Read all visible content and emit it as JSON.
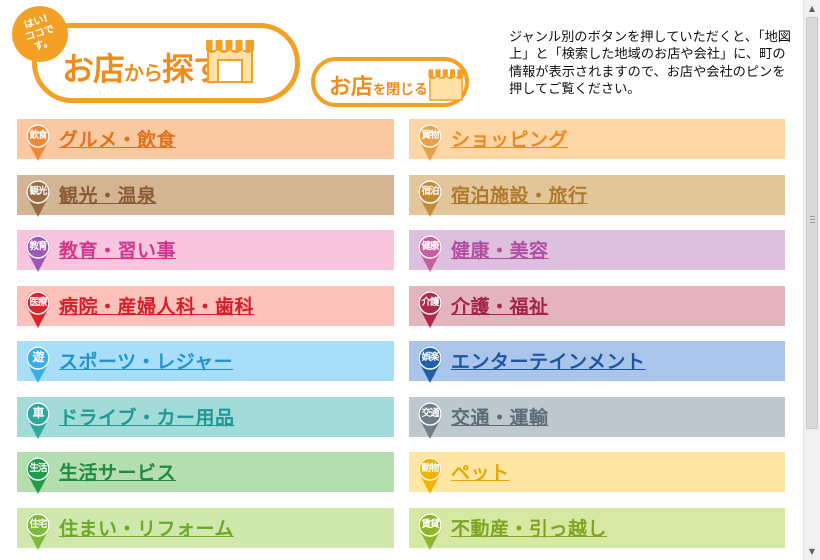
{
  "header": {
    "badge_line1": "はい!",
    "badge_line2": "ココです。",
    "search_title_big": "お店",
    "search_title_small": "から",
    "search_title_end": "探す!",
    "close_big": "お店",
    "close_small": "を",
    "close_end": "閉じる!",
    "instructions": "ジャンル別のボタンを押していただくと、「地図上」と「検索した地域のお店や会社」に、町の情報が表示されますので、お店や会社のピンを押してご覧ください。",
    "accent_color": "#f4a024"
  },
  "genres": [
    {
      "icon": "飲食",
      "label": "グルメ・飲食",
      "bg": "#fbc9a1",
      "pin": "#ee8a3a",
      "text": "#e0701e"
    },
    {
      "icon": "買物",
      "label": "ショッピング",
      "bg": "#fdd6a6",
      "pin": "#e8a146",
      "text": "#e98a25"
    },
    {
      "icon": "観光",
      "label": "観光・温泉",
      "bg": "#d3b596",
      "pin": "#9a6a44",
      "text": "#8c5a33"
    },
    {
      "icon": "宿泊",
      "label": "宿泊施設・旅行",
      "bg": "#e2c598",
      "pin": "#c08b3a",
      "text": "#b07a2c"
    },
    {
      "icon": "教育",
      "label": "教育・習い事",
      "bg": "#f9c5de",
      "pin": "#9b58b5",
      "text": "#d0378c"
    },
    {
      "icon": "健康",
      "label": "健康・美容",
      "bg": "#dcc0de",
      "pin": "#c85e9f",
      "text": "#b24ea0"
    },
    {
      "icon": "医療",
      "label": "病院・産婦人科・歯科",
      "bg": "#fcc1ba",
      "pin": "#d8262e",
      "text": "#d31f29"
    },
    {
      "icon": "介護",
      "label": "介護・福祉",
      "bg": "#e4b4bd",
      "pin": "#b0284a",
      "text": "#a4244a"
    },
    {
      "icon": "遊",
      "label": "スポーツ・レジャー",
      "bg": "#a9def8",
      "pin": "#3aaee3",
      "text": "#2293cf"
    },
    {
      "icon": "娯楽",
      "label": "エンターテインメント",
      "bg": "#a9c5ea",
      "pin": "#225fa9",
      "text": "#1d56a3"
    },
    {
      "icon": "車",
      "label": "ドライブ・カー用品",
      "bg": "#a3dbd8",
      "pin": "#2fa6a0",
      "text": "#1f9994"
    },
    {
      "icon": "交通",
      "label": "交通・運輸",
      "bg": "#bec8cf",
      "pin": "#6e7f8a",
      "text": "#5b6c78"
    },
    {
      "icon": "生活",
      "label": "生活サービス",
      "bg": "#b4ddb0",
      "pin": "#24994a",
      "text": "#1f8b41"
    },
    {
      "icon": "動物",
      "label": "ペット",
      "bg": "#ffe7a3",
      "pin": "#f0b400",
      "text": "#e7a600"
    },
    {
      "icon": "住宅",
      "label": "住まい・リフォーム",
      "bg": "#d0e8ac",
      "pin": "#7fba3c",
      "text": "#6aa92a"
    },
    {
      "icon": "賃貸",
      "label": "不動産・引っ越し",
      "bg": "#d7e8a2",
      "pin": "#8fb52c",
      "text": "#7ea423"
    }
  ]
}
